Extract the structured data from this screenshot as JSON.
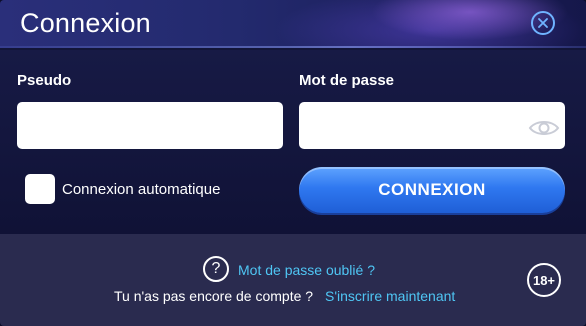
{
  "dialog": {
    "title": "Connexion",
    "close_icon": "close-icon"
  },
  "form": {
    "username_label": "Pseudo",
    "username_value": "",
    "password_label": "Mot de passe",
    "password_value": "",
    "show_password_icon": "eye-icon",
    "auto_login_label": "Connexion automatique",
    "auto_login_checked": false,
    "submit_label": "CONNEXION"
  },
  "footer": {
    "help_icon": "question-circle-icon",
    "forgot_password_label": "Mot de passe oublié ?",
    "no_account_text": "Tu n'as pas encore de compte ?",
    "signup_label": "S'inscrire maintenant",
    "age_rating": "18+"
  },
  "colors": {
    "accent_blue": "#2f78f0",
    "link_cyan": "#4fc6f4",
    "background": "#121538",
    "footer_background": "#2a2b4f"
  }
}
